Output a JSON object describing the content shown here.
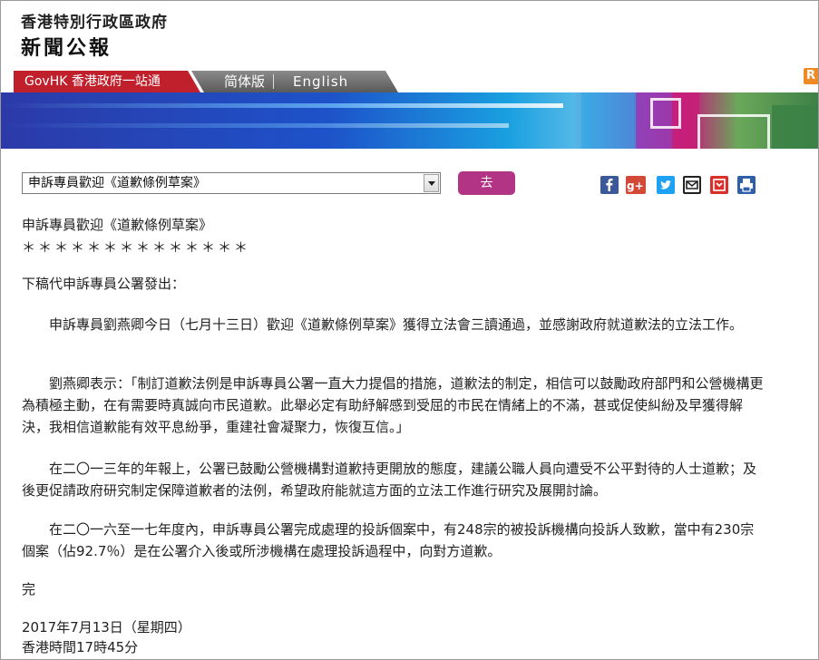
{
  "header": {
    "gov_name": "香港特別行政區政府",
    "press_title": "新聞公報"
  },
  "nav": {
    "govhk": "GovHK 香港政府一站通",
    "simplified": "简体版",
    "english": "English",
    "rss": "R"
  },
  "toolbar": {
    "select_value": "申訴專員歡迎《道歉條例草案》",
    "go_label": "去",
    "share_icons": [
      "facebook-icon",
      "google-plus-icon",
      "twitter-icon",
      "email-icon",
      "bookmark-icon",
      "print-icon"
    ]
  },
  "article": {
    "title": "申訴專員歡迎《道歉條例草案》",
    "stars": "＊＊＊＊＊＊＊＊＊＊＊＊＊＊",
    "intro": "下稿代申訴專員公署發出：",
    "paragraphs": [
      "申訴專員劉燕卿今日（七月十三日）歡迎《道歉條例草案》獲得立法會三讀通過，並感謝政府就道歉法的立法工作。",
      "劉燕卿表示：「制訂道歉法例是申訴專員公署一直大力提倡的措施，道歉法的制定，相信可以鼓勵政府部門和公營機構更為積極主動，在有需要時真誠向市民道歉。此舉必定有助紓解感到受屈的市民在情緒上的不滿，甚或促使糾紛及早獲得解決，我相信道歉能有效平息紛爭，重建社會凝聚力，恢復互信。」",
      "在二〇一三年的年報上，公署已鼓勵公營機構對道歉持更開放的態度，建議公職人員向遭受不公平對待的人士道歉；及後更促請政府研究制定保障道歉者的法例，希望政府能就這方面的立法工作進行研究及展開討論。",
      "在二〇一六至一七年度內，申訴專員公署完成處理的投訴個案中，有248宗的被投訴機構向投訴人致歉，當中有230宗個案（佔92.7％）是在公署介入後或所涉機構在處理投訴過程中，向對方道歉。"
    ],
    "end": "完",
    "date": "2017年7月13日（星期四）",
    "time": "香港時間17時45分"
  },
  "colors": {
    "govhk_red": "#c0202c",
    "go_button": "#b23585",
    "facebook": "#3b5998",
    "google_plus": "#d34836",
    "twitter": "#1da1f2",
    "bookmark": "#d9302c",
    "print": "#2f5fa8"
  }
}
